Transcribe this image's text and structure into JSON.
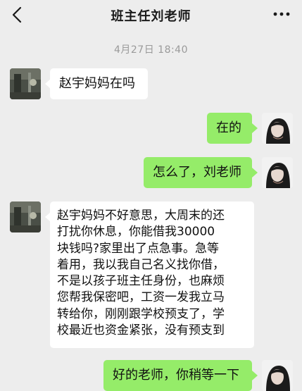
{
  "header": {
    "title": "班主任刘老师",
    "back_icon": "chevron-left-icon",
    "more_icon": "more-dots-icon"
  },
  "timestamp": "4月27日  18:40",
  "messages": [
    {
      "side": "left",
      "sender": "teacher",
      "text": "赵宇妈妈在吗"
    },
    {
      "side": "right",
      "sender": "me",
      "text": "在的"
    },
    {
      "side": "right",
      "sender": "me",
      "text": "怎么了，刘老师"
    },
    {
      "side": "left",
      "sender": "teacher",
      "text": "赵宇妈妈不好意思，大周末的还\n打扰你休息，你能借我30000\n块钱吗?家里出了点急事。急等\n着用，我以我自己名义找你借，\n不是以孩子班主任身份，也麻烦\n您帮我保密吧，工资一发我立马\n转给你，刚刚跟学校预支了，学\n校最近也资金紧张，没有预支到"
    },
    {
      "side": "right",
      "sender": "me",
      "text": "好的老师，你稍等一下"
    }
  ],
  "colors": {
    "background": "#ededed",
    "bubble_left": "#ffffff",
    "bubble_right": "#95ec69",
    "timestamp": "#9a9a9a"
  }
}
